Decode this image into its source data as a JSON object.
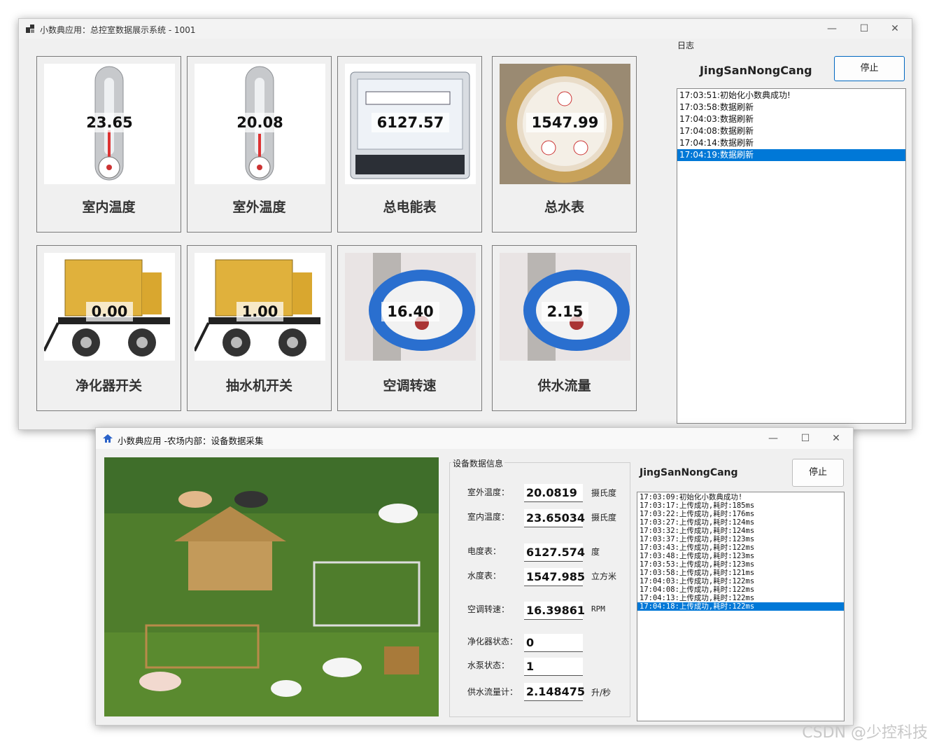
{
  "main_window": {
    "title": "小数典应用：总控室数据展示系统 - 1001",
    "tiles": [
      {
        "value": "23.65",
        "label": "室内温度",
        "icon": "thermometer-icon"
      },
      {
        "value": "20.08",
        "label": "室外温度",
        "icon": "thermometer-icon"
      },
      {
        "value": "6127.57",
        "label": "总电能表",
        "icon": "electric-meter-icon"
      },
      {
        "value": "1547.99",
        "label": "总水表",
        "icon": "water-meter-icon"
      },
      {
        "value": "0.00",
        "label": "净化器开关",
        "icon": "generator-icon"
      },
      {
        "value": "1.00",
        "label": "抽水机开关",
        "icon": "generator-icon"
      },
      {
        "value": "16.40",
        "label": "空调转速",
        "icon": "flowmeter-icon"
      },
      {
        "value": "2.15",
        "label": "供水流量",
        "icon": "flowmeter-icon"
      }
    ],
    "log_group_title": "日志",
    "brand": "JingSanNongCang",
    "stop_label": "停止",
    "log": [
      "17:03:51:初始化小数典成功!",
      "17:03:58:数据刷新",
      "17:04:03:数据刷新",
      "17:04:08:数据刷新",
      "17:04:14:数据刷新",
      "17:04:19:数据刷新"
    ]
  },
  "collect_window": {
    "title": "小数典应用 -农场内部：设备数据采集",
    "group_title": "设备数据信息",
    "fields": [
      {
        "label": "室外温度：",
        "value": "20.0819",
        "unit": "摄氏度"
      },
      {
        "label": "室内温度：",
        "value": "23.65034",
        "unit": "摄氏度"
      },
      {
        "label": "电度表：",
        "value": "6127.574",
        "unit": "度"
      },
      {
        "label": "水度表：",
        "value": "1547.985",
        "unit": "立方米"
      },
      {
        "label": "空调转速：",
        "value": "16.39861",
        "unit": "RPM"
      },
      {
        "label": "净化器状态：",
        "value": "0",
        "unit": ""
      },
      {
        "label": "水泵状态：",
        "value": "1",
        "unit": ""
      },
      {
        "label": "供水流量计：",
        "value": "2.148475",
        "unit": "升/秒"
      }
    ],
    "brand": "JingSanNongCang",
    "stop_label": "停止",
    "log": [
      "17:03:09:初始化小数典成功!",
      "17:03:17:上传成功,耗时:185ms",
      "17:03:22:上传成功,耗时:176ms",
      "17:03:27:上传成功,耗时:124ms",
      "17:03:32:上传成功,耗时:124ms",
      "17:03:37:上传成功,耗时:123ms",
      "17:03:43:上传成功,耗时:122ms",
      "17:03:48:上传成功,耗时:123ms",
      "17:03:53:上传成功,耗时:123ms",
      "17:03:58:上传成功,耗时:121ms",
      "17:04:03:上传成功,耗时:122ms",
      "17:04:08:上传成功,耗时:122ms",
      "17:04:13:上传成功,耗时:122ms",
      "17:04:18:上传成功,耗时:122ms"
    ]
  },
  "watermark": "CSDN @少控科技",
  "colors": {
    "selection": "#0078d7",
    "primary_border": "#0067c0",
    "window_bg": "#f0f0f0"
  }
}
